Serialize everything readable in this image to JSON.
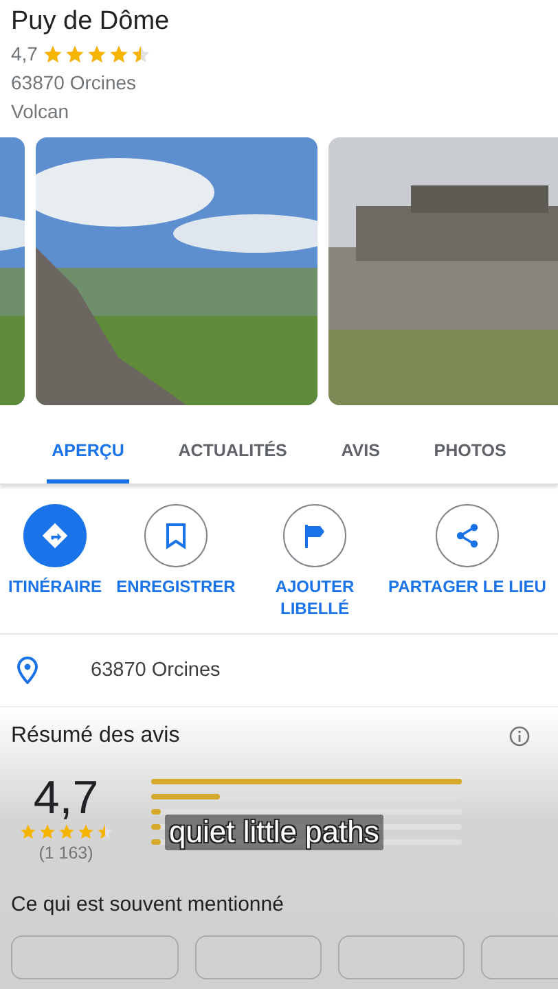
{
  "place": {
    "title": "Puy de Dôme",
    "rating": "4,7",
    "stars": 4.5,
    "address": "63870 Orcines",
    "category": "Volcan"
  },
  "photos": [
    {
      "kind": "landscape"
    },
    {
      "kind": "landscape"
    },
    {
      "kind": "building"
    }
  ],
  "tabs": [
    {
      "label": "APERÇU",
      "selected": true
    },
    {
      "label": "ACTUALITÉS",
      "selected": false
    },
    {
      "label": "AVIS",
      "selected": false
    },
    {
      "label": "PHOTOS",
      "selected": false
    }
  ],
  "actions": [
    {
      "kind": "directions",
      "label": "ITINÉRAIRE",
      "selected": true
    },
    {
      "kind": "save",
      "label": "ENREGISTRER",
      "selected": false
    },
    {
      "kind": "label",
      "label": "AJOUTER LIBELLÉ",
      "selected": false
    },
    {
      "kind": "share",
      "label": "PARTAGER LE LIEU",
      "selected": false
    }
  ],
  "address_row": {
    "text": "63870 Orcines"
  },
  "review_summary": {
    "title": "Résumé des avis",
    "rating": "4,7",
    "stars": 4.5,
    "count": "(1 163)",
    "bars": [
      {
        "level": 1.0
      },
      {
        "level": 0.22
      },
      {
        "level": 0.03
      },
      {
        "level": 0.03
      },
      {
        "level": 0.03
      }
    ]
  },
  "caption": "quiet little paths",
  "mentions": {
    "title": "Ce qui est souvent mentionné"
  }
}
